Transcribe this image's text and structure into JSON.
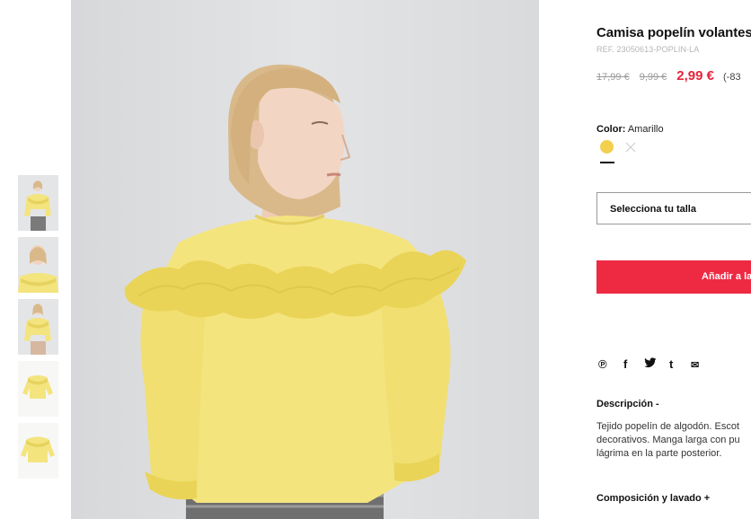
{
  "product": {
    "title": "Camisa popelín volantes",
    "ref": "REF. 23050613-POPLIN-LA",
    "price_original": "17,99 €",
    "price_previous": "9,99 €",
    "price_current": "2,99 €",
    "discount": "(-83"
  },
  "color": {
    "label": "Color:",
    "value": "Amarillo",
    "swatches": [
      {
        "name": "Amarillo",
        "hex": "#f2cf4d",
        "selected": true
      },
      {
        "name": "unavailable",
        "hex": "#ffffff",
        "selected": false
      }
    ]
  },
  "size": {
    "placeholder": "Selecciona tu talla"
  },
  "cart": {
    "add_label": "Añadir a la"
  },
  "share": {
    "icons": [
      "pinterest-icon",
      "facebook-icon",
      "twitter-icon",
      "tumblr-icon",
      "email-icon"
    ],
    "glyphs": [
      "℗",
      "f",
      "t",
      "t",
      "✉"
    ]
  },
  "description": {
    "heading": "Descripción -",
    "lines": [
      "Tejido popelín de algodón. Escot",
      "decorativos. Manga larga con pu",
      "lágrima en la parte posterior."
    ]
  },
  "composition": {
    "heading": "Composición y lavado +"
  },
  "gallery": {
    "thumbnails": [
      "front-view",
      "closeup-view",
      "front-view-2",
      "garment-flat",
      "garment-flat-2"
    ],
    "colors": {
      "shirt": "#f4e47e",
      "shirt_shadow": "#e6d35f",
      "background": "#dedfe1",
      "skin": "#f0d3bf",
      "hair": "#d9b98a"
    }
  }
}
